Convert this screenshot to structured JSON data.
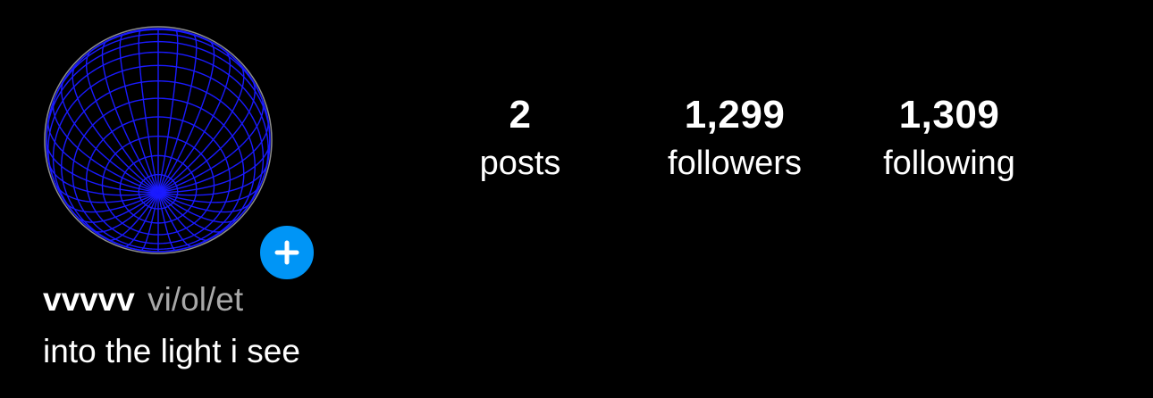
{
  "profile": {
    "username": "vvvvv",
    "pronouns": "vi/ol/et",
    "bio": "into the light i see",
    "avatar_icon": "wireframe-globe",
    "add_story_icon": "plus-icon"
  },
  "stats": {
    "posts": {
      "count": "2",
      "label": "posts"
    },
    "followers": {
      "count": "1,299",
      "label": "followers"
    },
    "following": {
      "count": "1,309",
      "label": "following"
    }
  },
  "colors": {
    "background": "#000000",
    "text": "#ffffff",
    "secondary_text": "#a8a8a8",
    "accent": "#0095f6",
    "globe_lines": "#1a1aff"
  }
}
